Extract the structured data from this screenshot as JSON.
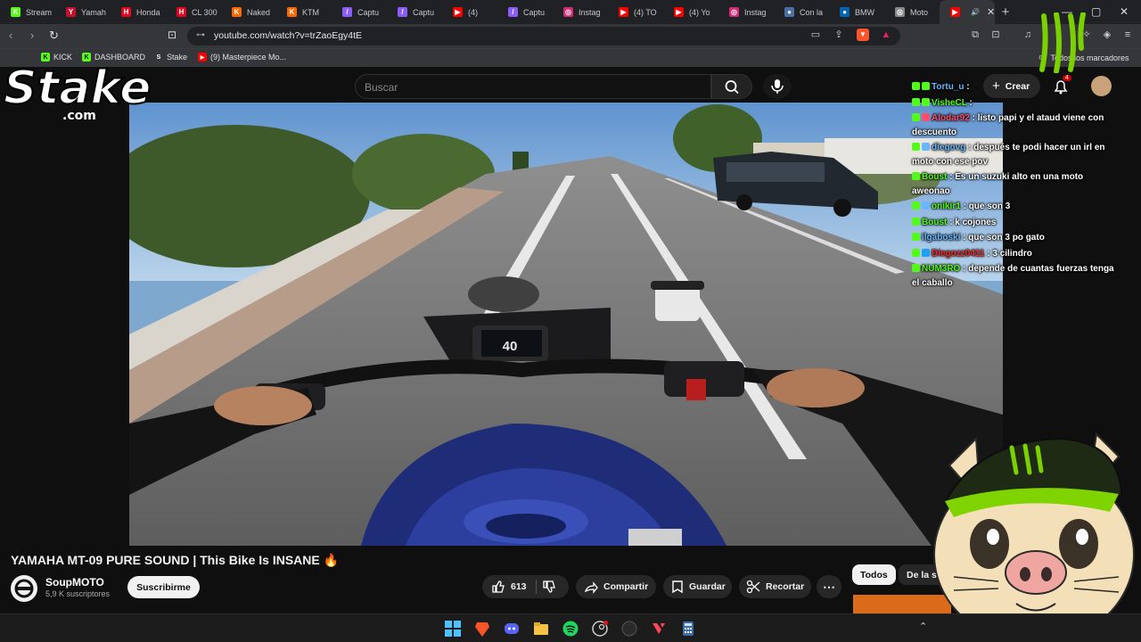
{
  "browser": {
    "tabs": [
      {
        "label": "Stream",
        "color": "#53fc18",
        "glyph": "K"
      },
      {
        "label": "Yamah",
        "color": "#c8102e",
        "glyph": "Y"
      },
      {
        "label": "Honda",
        "color": "#e40521",
        "glyph": "H"
      },
      {
        "label": "CL 300",
        "color": "#e40521",
        "glyph": "H"
      },
      {
        "label": "Naked",
        "color": "#ff6600",
        "glyph": "K"
      },
      {
        "label": "KTM",
        "color": "#ff6600",
        "glyph": "K"
      },
      {
        "label": "Captu",
        "color": "#8b5cf6",
        "glyph": "/"
      },
      {
        "label": "Captu",
        "color": "#8b5cf6",
        "glyph": "/"
      },
      {
        "label": "(4)",
        "color": "#ff0000",
        "glyph": "▶"
      },
      {
        "label": "Captu",
        "color": "#8b5cf6",
        "glyph": "/"
      },
      {
        "label": "Instag",
        "color": "#d62976",
        "glyph": "◎"
      },
      {
        "label": "(4) TO",
        "color": "#ff0000",
        "glyph": "▶"
      },
      {
        "label": "(4) Yo",
        "color": "#ff0000",
        "glyph": "▶"
      },
      {
        "label": "Instag",
        "color": "#d62976",
        "glyph": "◎"
      },
      {
        "label": "Con la",
        "color": "#4a6fa5",
        "glyph": "●"
      },
      {
        "label": "BMW",
        "color": "#0066b1",
        "glyph": "●"
      },
      {
        "label": "Moto",
        "color": "#888888",
        "glyph": "◎"
      },
      {
        "label": "",
        "color": "#ff0000",
        "glyph": "▶"
      }
    ],
    "url": "youtube.com/watch?v=trZaoEgy4tE",
    "bookmarks": [
      {
        "label": "KICK",
        "color": "#53fc18",
        "glyph": "K"
      },
      {
        "label": "DASHBOARD",
        "color": "#53fc18",
        "glyph": "K"
      },
      {
        "label": "Stake",
        "color": "#ffffff",
        "glyph": "S"
      },
      {
        "label": "(9) Masterpiece Mo...",
        "color": "#ff0000",
        "glyph": "▶"
      }
    ],
    "all_bookmarks": "Todos los marcadores"
  },
  "youtube": {
    "search_placeholder": "Buscar",
    "create_label": "Crear",
    "notifications_count": "4",
    "video_title": "YAMAHA MT-09 PURE SOUND | This Bike Is INSANE 🔥",
    "channel_name": "SoupMOTO",
    "channel_subs": "5,9 K suscriptores",
    "subscribe_label": "Suscribirme",
    "likes": "613",
    "share_label": "Compartir",
    "save_label": "Guardar",
    "clip_label": "Recortar",
    "chip_all": "Todos",
    "chip_series": "De la serie",
    "speedometer": "40"
  },
  "overlay": {
    "stake_brand": "Stake",
    "stake_domain": ".com",
    "chat": [
      {
        "user": "Tortu_u",
        "user_color": "#6ab7ff",
        "text": ""
      },
      {
        "user": "VisheCL",
        "user_color": "#53fc18",
        "text": ""
      },
      {
        "user": "Alodar92",
        "user_color": "#ff4d6d",
        "text": "listo papi y el ataud viene con descuento"
      },
      {
        "user": "diegovg",
        "user_color": "#6ab7ff",
        "text": "después te podi hacer un irl en moto con ese pov"
      },
      {
        "user": "Boust",
        "user_color": "#53fc18",
        "text": "Es un suzuki alto en una moto aweonao"
      },
      {
        "user": "onikir1",
        "user_color": "#53fc18",
        "text": "que son 3"
      },
      {
        "user": "Boust",
        "user_color": "#53fc18",
        "text": "k cojones"
      },
      {
        "user": "ilgaboski",
        "user_color": "#6ab7ff",
        "text": "que son 3 po gato"
      },
      {
        "user": "Diegozz0411",
        "user_color": "#ff2b2b",
        "text": "3 cilindro"
      },
      {
        "user": "NUM3RO",
        "user_color": "#53fc18",
        "text": "depende de cuantas fuerzas tenga el caballo"
      }
    ]
  }
}
